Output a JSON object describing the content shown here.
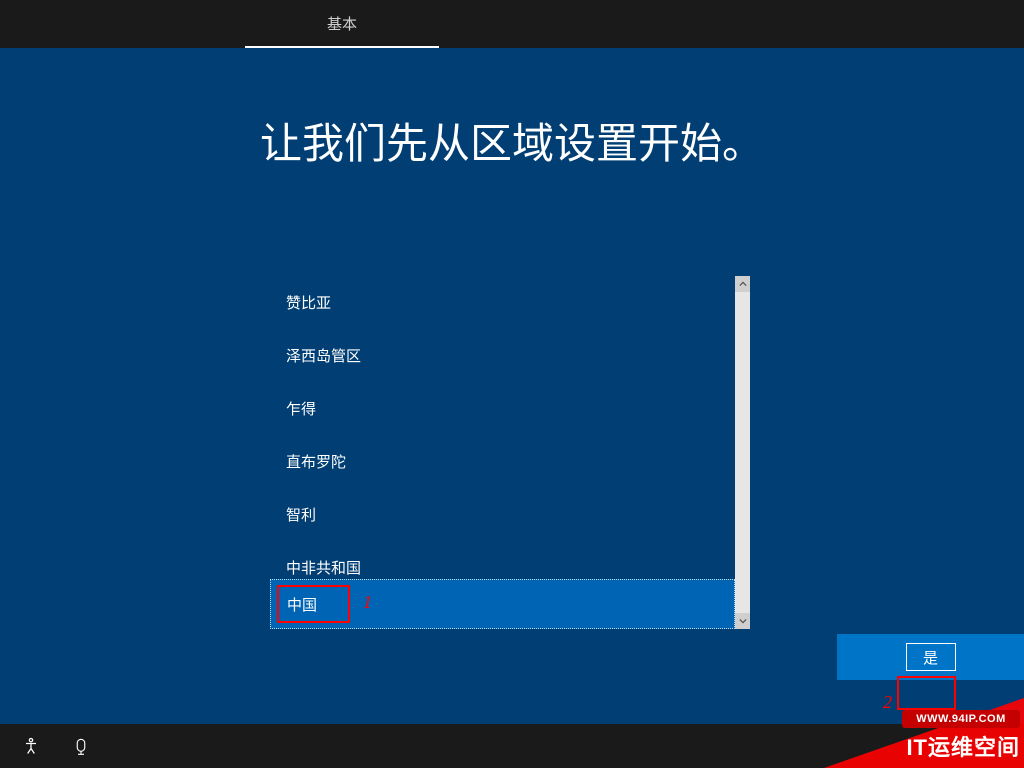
{
  "header": {
    "tab_label": "基本"
  },
  "main": {
    "title": "让我们先从区域设置开始。"
  },
  "region_list": {
    "items": [
      "赞比亚",
      "泽西岛管区",
      "乍得",
      "直布罗陀",
      "智利",
      "中非共和国"
    ],
    "selected": "中国"
  },
  "buttons": {
    "yes": "是"
  },
  "annotations": {
    "one": "1",
    "two": "2"
  },
  "watermark": {
    "url": "WWW.94IP.COM",
    "brand": "IT运维空间"
  }
}
